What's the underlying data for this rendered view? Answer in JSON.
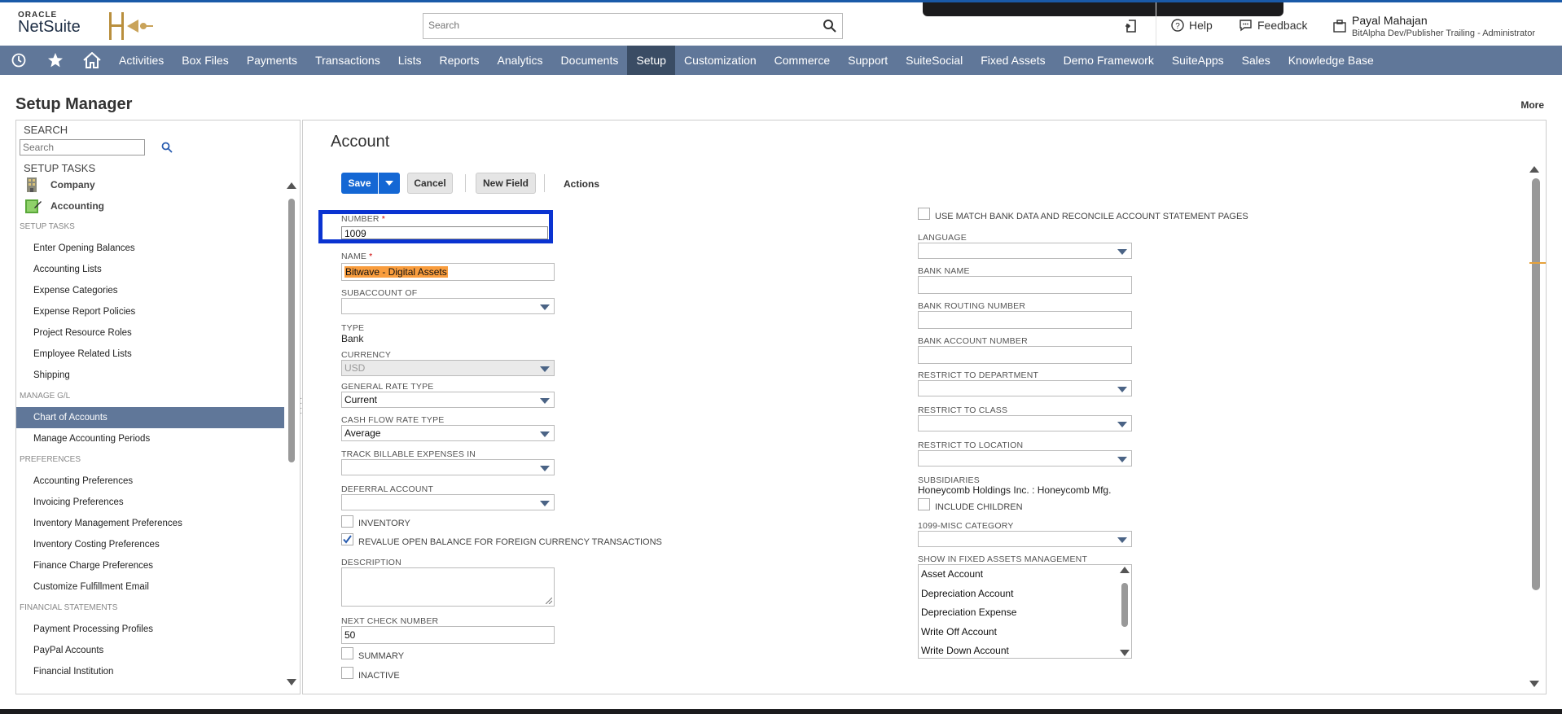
{
  "brand": {
    "oracle": "ORACLE",
    "netsuite": "NetSuite"
  },
  "search": {
    "placeholder": "Search"
  },
  "header": {
    "help": "Help",
    "feedback": "Feedback",
    "user_name": "Payal Mahajan",
    "user_role": "BitAlpha Dev/Publisher Trailing - Administrator"
  },
  "nav": {
    "items": [
      "Activities",
      "Box Files",
      "Payments",
      "Transactions",
      "Lists",
      "Reports",
      "Analytics",
      "Documents",
      "Setup",
      "Customization",
      "Commerce",
      "Support",
      "SuiteSocial",
      "Fixed Assets",
      "Demo Framework",
      "SuiteApps",
      "Sales",
      "Knowledge Base"
    ],
    "active": "Setup"
  },
  "page": {
    "title": "Setup Manager",
    "more": "More"
  },
  "sidebar": {
    "search_head": "SEARCH",
    "search_placeholder": "Search",
    "tasks_head": "SETUP TASKS",
    "tasks": [
      "Company",
      "Accounting"
    ],
    "sections": [
      {
        "title": "SETUP TASKS",
        "items": [
          "Enter Opening Balances",
          "Accounting Lists",
          "Expense Categories",
          "Expense Report Policies",
          "Project Resource Roles",
          "Employee Related Lists",
          "Shipping"
        ]
      },
      {
        "title": "MANAGE G/L",
        "items": [
          "Chart of Accounts",
          "Manage Accounting Periods"
        ]
      },
      {
        "title": "PREFERENCES",
        "items": [
          "Accounting Preferences",
          "Invoicing Preferences",
          "Inventory Management Preferences",
          "Inventory Costing Preferences",
          "Finance Charge Preferences",
          "Customize Fulfillment Email"
        ]
      },
      {
        "title": "FINANCIAL STATEMENTS",
        "items": [
          "Payment Processing Profiles",
          "PayPal Accounts",
          "Financial Institution"
        ]
      }
    ],
    "active_item": "Chart of Accounts"
  },
  "form": {
    "title": "Account",
    "buttons": {
      "save": "Save",
      "cancel": "Cancel",
      "new_field": "New Field",
      "actions": "Actions"
    },
    "left": {
      "number_label": "NUMBER",
      "number_value": "1009",
      "name_label": "NAME",
      "name_value": "Bitwave - Digital Assets",
      "subaccount_label": "SUBACCOUNT OF",
      "subaccount_value": "",
      "type_label": "TYPE",
      "type_value": "Bank",
      "currency_label": "CURRENCY",
      "currency_value": "USD",
      "grt_label": "GENERAL RATE TYPE",
      "grt_value": "Current",
      "cfrt_label": "CASH FLOW RATE TYPE",
      "cfrt_value": "Average",
      "tbe_label": "TRACK BILLABLE EXPENSES IN",
      "tbe_value": "",
      "deferral_label": "DEFERRAL ACCOUNT",
      "deferral_value": "",
      "inventory_label": "INVENTORY",
      "revalue_label": "REVALUE OPEN BALANCE FOR FOREIGN CURRENCY TRANSACTIONS",
      "description_label": "DESCRIPTION",
      "next_check_label": "NEXT CHECK NUMBER",
      "next_check_value": "50",
      "summary_label": "SUMMARY",
      "inactive_label": "INACTIVE"
    },
    "right": {
      "match_bank_label": "USE MATCH BANK DATA AND RECONCILE ACCOUNT STATEMENT PAGES",
      "language_label": "LANGUAGE",
      "bank_name_label": "BANK NAME",
      "bank_routing_label": "BANK ROUTING NUMBER",
      "bank_account_label": "BANK ACCOUNT NUMBER",
      "restrict_dept_label": "RESTRICT TO DEPARTMENT",
      "restrict_class_label": "RESTRICT TO CLASS",
      "restrict_loc_label": "RESTRICT TO LOCATION",
      "subsidiaries_label": "SUBSIDIARIES",
      "subsidiaries_value": "Honeycomb Holdings Inc. : Honeycomb Mfg.",
      "include_children_label": "INCLUDE CHILDREN",
      "misc1099_label": "1099-MISC CATEGORY",
      "fixed_assets_label": "SHOW IN FIXED ASSETS MANAGEMENT",
      "fixed_assets_options": [
        "Asset Account",
        "Depreciation Account",
        "Depreciation Expense",
        "Write Off Account",
        "Write Down Account"
      ]
    }
  },
  "colors": {
    "nav_bg": "#607799",
    "nav_active": "#3a4c64",
    "primary_button": "#1467d4",
    "focus_border": "#0a33d1",
    "highlight": "#f99d3e"
  }
}
